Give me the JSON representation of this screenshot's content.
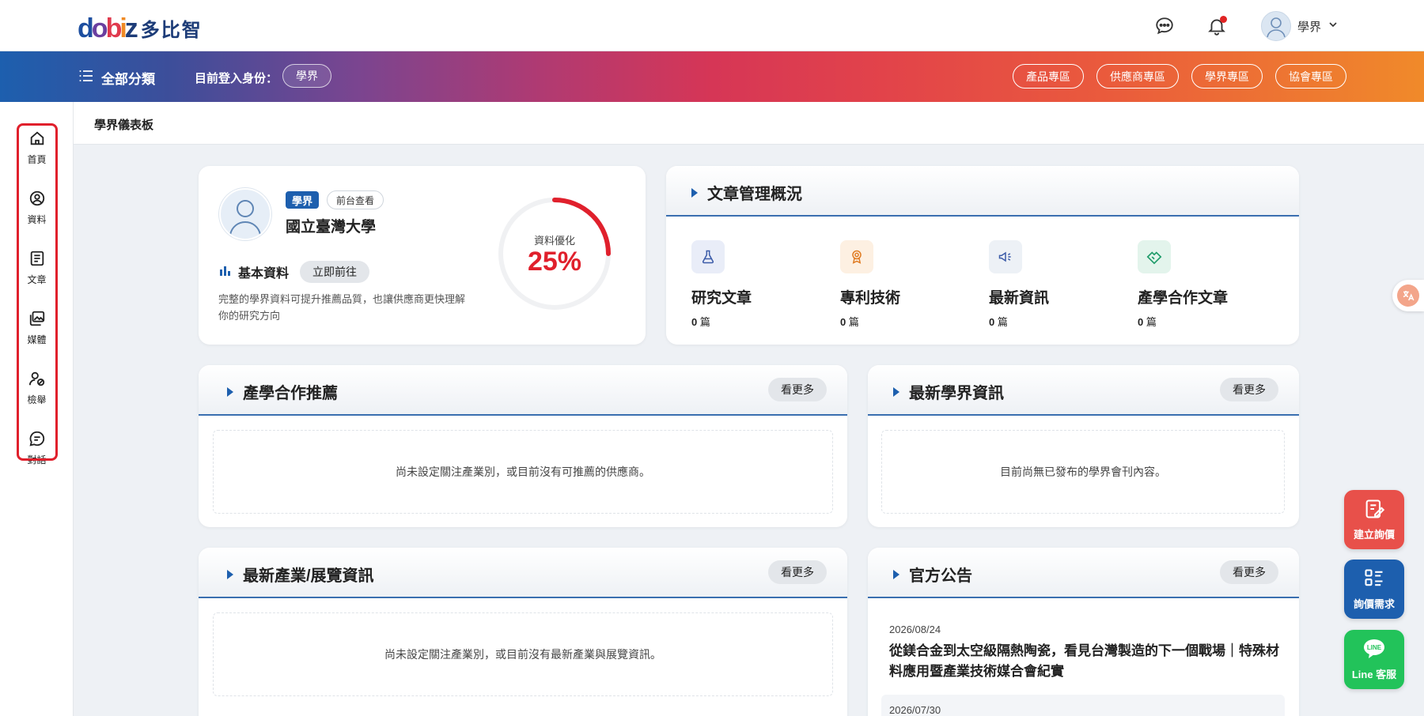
{
  "header": {
    "logo_mark": "dobiz",
    "logo_text": "多比智",
    "user_name": "學界"
  },
  "navbar": {
    "all_categories": "全部分類",
    "login_as_label": "目前登入身份：",
    "role": "學界",
    "zones": [
      "產品專區",
      "供應商專區",
      "學界專區",
      "協會專區"
    ]
  },
  "sidebar": {
    "items": [
      {
        "label": "首頁",
        "icon": "home-icon"
      },
      {
        "label": "資料",
        "icon": "profile-icon"
      },
      {
        "label": "文章",
        "icon": "article-icon"
      },
      {
        "label": "媒體",
        "icon": "media-icon"
      },
      {
        "label": "檢舉",
        "icon": "report-icon"
      },
      {
        "label": "對話",
        "icon": "chat-icon"
      }
    ]
  },
  "breadcrumb": "學界儀表板",
  "profile": {
    "role_tag": "學界",
    "front_view": "前台查看",
    "name": "國立臺灣大學",
    "basic_label": "基本資料",
    "goto_label": "立即前往",
    "description": "完整的學界資料可提升推薦品質，也讓供應商更快理解你的研究方向",
    "optimize_label": "資料優化",
    "optimize_value": "25%",
    "optimize_fraction": 0.25
  },
  "articles": {
    "title": "文章管理概況",
    "stats": [
      {
        "name": "研究文章",
        "count": "0",
        "unit": "篇",
        "icon": "flask-icon",
        "color": "#3b5ba8"
      },
      {
        "name": "專利技術",
        "count": "0",
        "unit": "篇",
        "icon": "award-icon",
        "color": "#e07b22"
      },
      {
        "name": "最新資訊",
        "count": "0",
        "unit": "篇",
        "icon": "megaphone-icon",
        "color": "#3b5ba8"
      },
      {
        "name": "產學合作文章",
        "count": "0",
        "unit": "篇",
        "icon": "handshake-icon",
        "color": "#1f9c6a"
      }
    ]
  },
  "recommend": {
    "title": "產學合作推薦",
    "more": "看更多",
    "empty": "尚未設定關注產業別，或目前沒有可推薦的供應商。"
  },
  "academic_news": {
    "title": "最新學界資訊",
    "more": "看更多",
    "empty": "目前尚無已發布的學界會刊內容。"
  },
  "industry_news": {
    "title": "最新產業/展覽資訊",
    "more": "看更多",
    "empty": "尚未設定關注產業別，或目前沒有最新產業與展覽資訊。"
  },
  "announcements": {
    "title": "官方公告",
    "more": "看更多",
    "items": [
      {
        "date": "2026/08/24",
        "title": "從鎂合金到太空級隔熱陶瓷，看見台灣製造的下一個戰場｜特殊材料應用暨產業技術媒合會紀實"
      },
      {
        "date": "2026/07/30",
        "title": ""
      }
    ]
  },
  "float_buttons": [
    {
      "label": "建立詢價",
      "icon": "edit-icon",
      "color": "#e8504a"
    },
    {
      "label": "詢價需求",
      "icon": "list-icon",
      "color": "#1d5fae"
    },
    {
      "label": "Line 客服",
      "icon": "line-icon",
      "color": "#22c35a"
    }
  ]
}
